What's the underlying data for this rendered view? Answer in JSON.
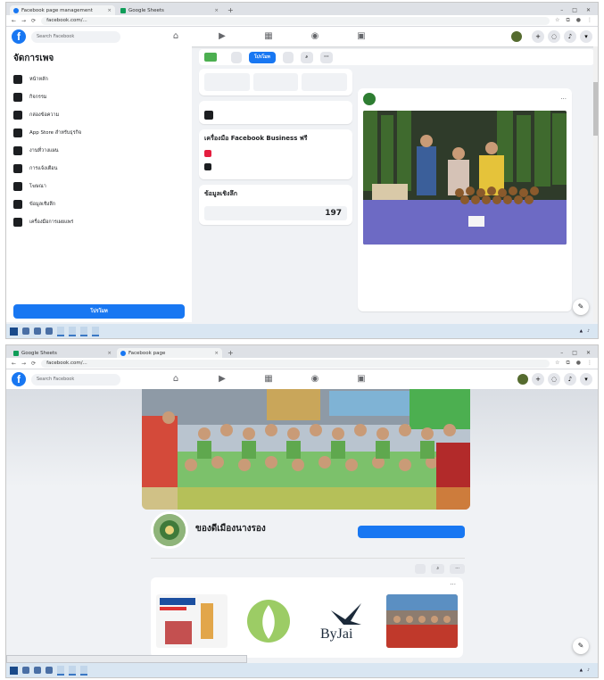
{
  "shot1": {
    "tabs": [
      {
        "label": "Facebook page management",
        "active": true
      },
      {
        "label": "Google Sheets",
        "active": false
      }
    ],
    "url": "facebook.com/...",
    "search_placeholder": "Search Facebook",
    "badges": {
      "notif1": "",
      "notif2": ""
    },
    "user_name": "",
    "sidebar": {
      "title": "จัดการเพจ",
      "subtitle": "",
      "items": [
        {
          "label": "หน้าหลัก",
          "sub": ""
        },
        {
          "label": "กิจกรรม",
          "sub": ""
        },
        {
          "label": "กล่องข้อความ",
          "sub": ""
        },
        {
          "label": "App Store สำหรับธุรกิจ",
          "sub": ""
        },
        {
          "label": "งานที่วางแผน",
          "sub": ""
        },
        {
          "label": "การแจ้งเตือน",
          "sub": ""
        },
        {
          "label": "โฆษณา",
          "sub": ""
        },
        {
          "label": "ข้อมูลเชิงลึก",
          "sub": ""
        },
        {
          "label": "เครื่องมือการเผยแพร่",
          "sub": ""
        }
      ],
      "promote_label": "โปรโมท"
    },
    "toolbar": {
      "page_label": "",
      "edit_label": "",
      "promote_label": "โปรโมท",
      "add_button_label": ""
    },
    "tip_card": {
      "title": "",
      "text": ""
    },
    "tools_card": {
      "title": "เครื่องมือ Facebook Business ฟรี",
      "items": [
        {
          "title": "",
          "text": ""
        },
        {
          "title": "",
          "text": ""
        }
      ]
    },
    "stats_card": {
      "title": "ข้อมูลเชิงลึก",
      "link": "",
      "period": "",
      "metric_label": "",
      "metric_value": "197"
    },
    "post": {
      "author": "",
      "meta": "",
      "text": "",
      "link_text": ""
    }
  },
  "shot2": {
    "tabs": [
      {
        "label": "Google Sheets",
        "active": false
      },
      {
        "label": "Facebook page",
        "active": true
      }
    ],
    "url": "facebook.com/...",
    "search_placeholder": "Search Facebook",
    "page_name": "ของดีเมืองนางรอง",
    "page_handle": "",
    "main_button": "",
    "page_tabs": [
      {
        "label": "",
        "active": true
      },
      {
        "label": "",
        "active": false
      },
      {
        "label": "",
        "active": false
      },
      {
        "label": "",
        "active": false
      },
      {
        "label": "",
        "active": false
      }
    ],
    "promote_btn": "",
    "related_title": "",
    "thumbs": [
      {
        "caption": ""
      },
      {
        "caption": ""
      },
      {
        "caption": "ByJai"
      },
      {
        "caption": ""
      }
    ],
    "status_url": ""
  },
  "taskbar": {
    "apps": [
      "",
      "",
      "",
      ""
    ],
    "clock": ""
  },
  "colors": {
    "facebook_blue": "#1877f2",
    "badge_red": "#e41e3f",
    "page_bg": "#f0f2f5"
  }
}
